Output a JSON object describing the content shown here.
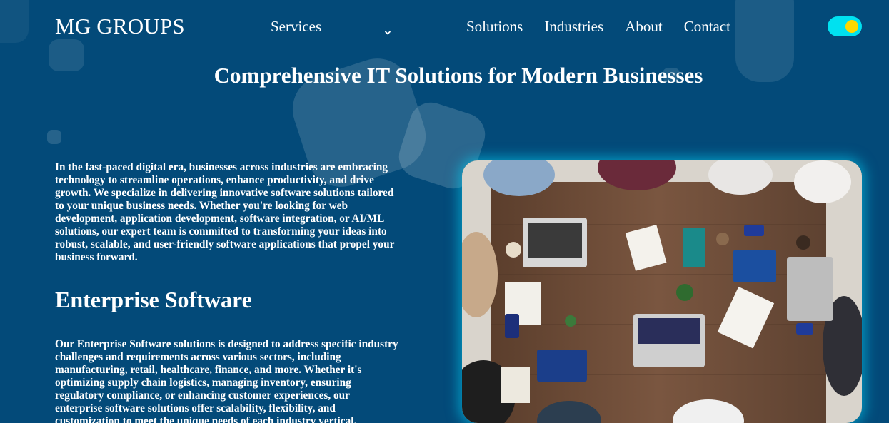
{
  "header": {
    "logo": "MG GROUPS",
    "services_label": "Services",
    "nav": [
      "Solutions",
      "Industries",
      "About",
      "Contact"
    ]
  },
  "hero": {
    "title": "Comprehensive IT Solutions for Modern Businesses"
  },
  "intro": {
    "text": "In the fast-paced digital era, businesses across industries are embracing technology to streamline operations, enhance productivity, and drive growth. We specialize in delivering innovative software solutions tailored to your unique business needs. Whether you're looking for web development, application development, software integration, or AI/ML solutions, our expert team is committed to transforming your ideas into robust, scalable, and user-friendly software applications that propel your business forward."
  },
  "enterprise": {
    "title": "Enterprise Software",
    "text": "Our Enterprise Software solutions is designed to address specific industry challenges and requirements across various sectors, including manufacturing, retail, healthcare, finance, and more. Whether it's optimizing supply chain logistics, managing inventory, ensuring regulatory compliance, or enhancing customer experiences, our enterprise software solutions offer scalability, flexibility, and customization to meet the unique needs of each industry vertical."
  },
  "colors": {
    "background": "#034a79",
    "toggle_track": "#00e1f0",
    "toggle_knob": "#ffd800",
    "photo_glow": "#00dcff"
  },
  "icons": {
    "services_dropdown": "chevron-down-icon",
    "theme_toggle": "toggle-icon"
  }
}
